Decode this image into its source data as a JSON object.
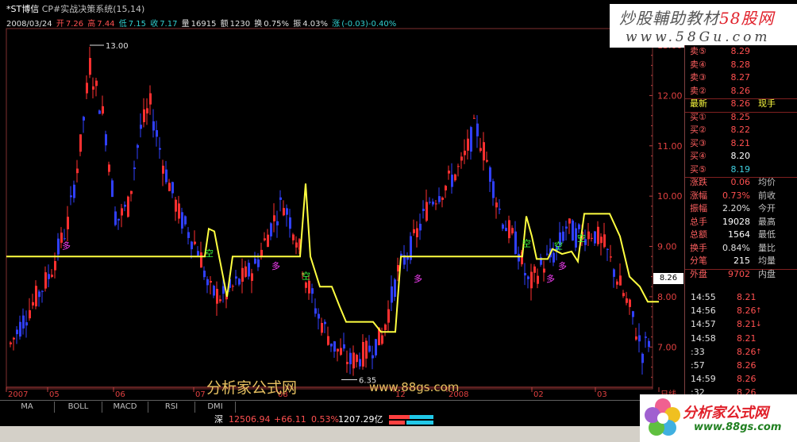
{
  "header": {
    "stock_name": "*ST博信",
    "indicator": "CP#实战决策系统(15,14)",
    "date": "2008/03/24",
    "open_label": "开",
    "open": "7.26",
    "high_label": "高",
    "high": "7.44",
    "low_label": "低",
    "low": "7.15",
    "close_label": "收",
    "close": "7.17",
    "volume_label": "量",
    "volume": "16915",
    "amount_label": "额",
    "amount": "1230",
    "turnover_label": "换",
    "turnover": "0.75%",
    "amplitude_label": "振",
    "amplitude": "4.03%",
    "change_label": "涨",
    "change": "(-0.03)-0.40%"
  },
  "watermark": {
    "text1a": "炒股輔助教材",
    "text1b": "58股网",
    "text2": "www.58Gu.com"
  },
  "center_watermark": {
    "text": "分析家公式网",
    "url": "www.88gs.com"
  },
  "logo": {
    "text": "分析家公式网",
    "url": "www.88gs.com"
  },
  "price_tag": "8.26",
  "order_book": {
    "asks": [
      {
        "label": "卖⑤",
        "price": "8.29"
      },
      {
        "label": "卖④",
        "price": "8.28"
      },
      {
        "label": "卖③",
        "price": "8.27"
      },
      {
        "label": "卖②",
        "price": "8.26"
      }
    ],
    "latest": {
      "label": "最新",
      "price": "8.26",
      "extra": "现手"
    },
    "bids": [
      {
        "label": "买①",
        "price": "8.25"
      },
      {
        "label": "买②",
        "price": "8.22"
      },
      {
        "label": "买③",
        "price": "8.21"
      },
      {
        "label": "买④",
        "price": "8.20"
      },
      {
        "label": "买⑤",
        "price": "8.19"
      }
    ]
  },
  "stats": [
    {
      "label": "涨跌",
      "value": "0.06",
      "extra": "均价"
    },
    {
      "label": "涨幅",
      "value": "0.73%",
      "extra": "前收"
    },
    {
      "label": "振幅",
      "value": "2.20%",
      "extra": "今开"
    },
    {
      "label": "总手",
      "value": "19028",
      "extra": "最高"
    },
    {
      "label": "总额",
      "value": "1564",
      "extra": "最低"
    },
    {
      "label": "换手",
      "value": "0.84%",
      "extra": "量比"
    },
    {
      "label": "分笔",
      "value": "215",
      "extra": "均量"
    }
  ],
  "outer_inner": {
    "label": "外盘",
    "value": "9702",
    "extra": "内盘"
  },
  "ticks": [
    {
      "time": "14:55",
      "price": "8.21",
      "arrow": ""
    },
    {
      "time": "14:56",
      "price": "8.26",
      "arrow": "↑"
    },
    {
      "time": "14:57",
      "price": "8.21",
      "arrow": "↓"
    },
    {
      "time": "14:58",
      "price": "8.21",
      "arrow": ""
    },
    {
      "time": ":33",
      "price": "8.26",
      "arrow": "↑"
    },
    {
      "time": ":57",
      "price": "8.26",
      "arrow": ""
    },
    {
      "time": "14:59",
      "price": "8.26",
      "arrow": ""
    },
    {
      "time": ":32",
      "price": "8.26",
      "arrow": ""
    }
  ],
  "tabs": [
    "MA",
    "BOLL",
    "MACD",
    "RSI",
    "DMI"
  ],
  "status": {
    "market": "深",
    "index": "12506.94",
    "change": "+66.11",
    "pct": "0.53%",
    "amount": "1207.29亿"
  },
  "chart_data": {
    "type": "candlestick",
    "ylim": [
      6.2,
      13.3
    ],
    "y_ticks": [
      "13.00",
      "12.00",
      "11.00",
      "10.00",
      "9.00",
      "8.00",
      "7.00"
    ],
    "x_labels": [
      "2007",
      "05",
      "06",
      "07",
      "08",
      "12",
      "2008",
      "02",
      "03",
      "日线"
    ],
    "max_label": "13.00",
    "min_label": "6.35",
    "buy_markers": [
      "多",
      "多",
      "多",
      "多",
      "多"
    ],
    "sell_markers": [
      "空",
      "空",
      "空",
      "空",
      "空"
    ],
    "support_series": [
      [
        0,
        8.8
      ],
      [
        250,
        8.8
      ],
      [
        255,
        9.35
      ],
      [
        262,
        9.3
      ],
      [
        268,
        8.8
      ],
      [
        278,
        8.0
      ],
      [
        285,
        8.8
      ],
      [
        370,
        8.8
      ],
      [
        377,
        10.25
      ],
      [
        383,
        8.8
      ],
      [
        395,
        8.2
      ],
      [
        410,
        8.2
      ],
      [
        420,
        7.8
      ],
      [
        428,
        7.5
      ],
      [
        462,
        7.5
      ],
      [
        472,
        7.3
      ],
      [
        490,
        7.3
      ],
      [
        497,
        8.8
      ],
      [
        650,
        8.8
      ],
      [
        655,
        9.6
      ],
      [
        662,
        9.2
      ],
      [
        668,
        8.75
      ],
      [
        682,
        8.75
      ],
      [
        688,
        8.95
      ],
      [
        700,
        8.85
      ],
      [
        712,
        8.9
      ],
      [
        720,
        8.7
      ],
      [
        728,
        9.65
      ],
      [
        760,
        9.65
      ],
      [
        773,
        9.2
      ],
      [
        785,
        8.4
      ],
      [
        798,
        8.2
      ],
      [
        808,
        7.9
      ],
      [
        822,
        7.9
      ]
    ]
  }
}
